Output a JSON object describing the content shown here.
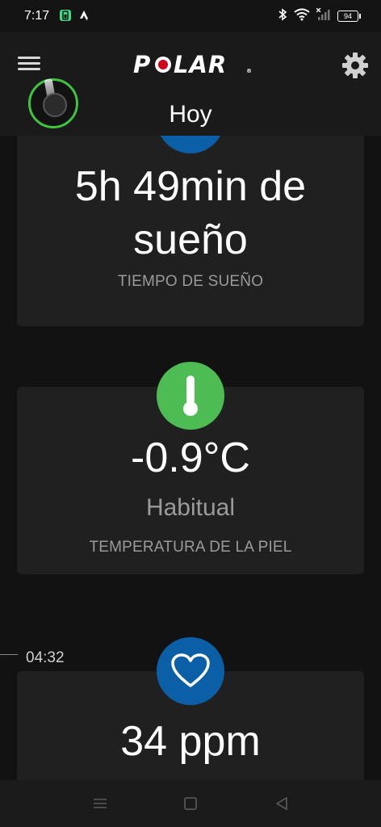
{
  "status_bar": {
    "time": "7:17",
    "battery_level": "94",
    "icons": [
      "battery-saver-icon",
      "strava-icon",
      "bluetooth-icon",
      "wifi-icon",
      "signal-icon"
    ]
  },
  "header": {
    "brand": "POLAR",
    "title": "Hoy",
    "menu_icon": "hamburger-menu-icon",
    "settings_icon": "gear-icon",
    "device_icon": "watch-icon"
  },
  "cards": {
    "sleep": {
      "value": "5h 49min de sueño",
      "label": "TIEMPO DE SUEÑO",
      "icon": "sleep-icon"
    },
    "skin_temp": {
      "value": "-0.9°C",
      "status": "Habitual",
      "label": "TEMPERATURA DE LA PIEL",
      "icon": "thermometer-icon",
      "icon_color": "#4cbc53"
    },
    "heart_rate": {
      "value": "34 ppm",
      "icon": "heart-icon",
      "icon_color": "#0b5fa6"
    }
  },
  "timeline": {
    "time": "04:32"
  },
  "nav_bar": {
    "items": [
      "recent-apps-icon",
      "home-icon",
      "back-icon"
    ]
  },
  "colors": {
    "background": "#121212",
    "card": "#202020",
    "accent_green": "#3ec43e",
    "brand_red": "#d0021b"
  }
}
